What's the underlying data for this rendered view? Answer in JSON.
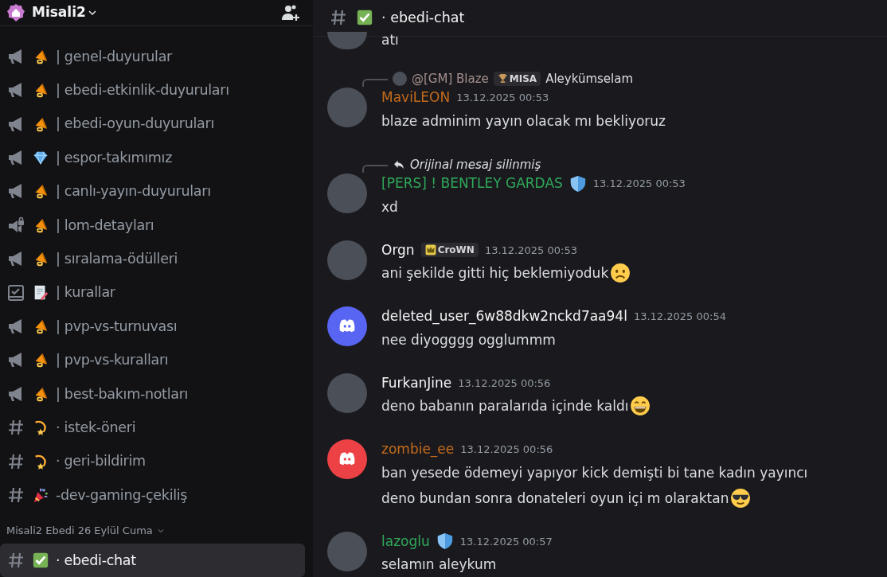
{
  "server": {
    "name": "Misali2"
  },
  "channels": [
    {
      "kind": "announcement",
      "emoji": {
        "kind": "megaphone"
      },
      "name": "| genel-duyurular"
    },
    {
      "kind": "announcement",
      "emoji": {
        "kind": "megaphone"
      },
      "name": "| ebedi-etkinlik-duyuruları"
    },
    {
      "kind": "announcement",
      "emoji": {
        "kind": "megaphone"
      },
      "name": "| ebedi-oyun-duyuruları"
    },
    {
      "kind": "announcement",
      "emoji": {
        "kind": "diamond"
      },
      "name": "| espor-takımımız"
    },
    {
      "kind": "announcement",
      "emoji": {
        "kind": "megaphone"
      },
      "name": "| canlı-yayın-duyuruları"
    },
    {
      "kind": "locked",
      "emoji": {
        "kind": "megaphone"
      },
      "name": "| lom-detayları"
    },
    {
      "kind": "announcement",
      "emoji": {
        "kind": "megaphone"
      },
      "name": "| sıralama-ödülleri"
    },
    {
      "kind": "rules",
      "emoji": {
        "kind": "memo"
      },
      "name": "| kurallar"
    },
    {
      "kind": "announcement",
      "emoji": {
        "kind": "megaphone"
      },
      "name": "| pvp-vs-turnuvası"
    },
    {
      "kind": "announcement",
      "emoji": {
        "kind": "megaphone"
      },
      "name": "| pvp-vs-kuralları"
    },
    {
      "kind": "announcement",
      "emoji": {
        "kind": "megaphone"
      },
      "name": "| best-bakım-notları"
    },
    {
      "kind": "text",
      "emoji": {
        "kind": "dizzy"
      },
      "name": "· istek-öneri"
    },
    {
      "kind": "text",
      "emoji": {
        "kind": "dizzy"
      },
      "name": "· geri-bildirim"
    },
    {
      "kind": "text",
      "emoji": {
        "kind": "party"
      },
      "name": "-dev-gaming-çekiliş"
    }
  ],
  "category": {
    "name": "Misali2 Ebedi 26 Eylül Cuma",
    "channels": [
      {
        "kind": "text",
        "emoji": {
          "kind": "check"
        },
        "name": "· ebedi-chat",
        "selected": true
      }
    ]
  },
  "header": {
    "emoji": {
      "kind": "check"
    },
    "channel": "· ebedi-chat"
  },
  "messages": [
    {
      "kind": "continuation",
      "avatar": {
        "kind": "photo"
      },
      "text": "atı"
    },
    {
      "kind": "full",
      "avatar": {
        "kind": "photo"
      },
      "reply": {
        "kind": "mention",
        "author": "@[GM] Blaze",
        "tag": "MISA",
        "text": "Aleykümselam"
      },
      "author": "MaviLEON",
      "color": "#c46a1b",
      "timestamp": "13.12.2025 00:53",
      "lines": [
        {
          "text": "blaze adminim yayın olacak mı bekliyoruz"
        }
      ]
    },
    {
      "kind": "full",
      "avatar": {
        "kind": "photo"
      },
      "reply": {
        "kind": "deleted",
        "text": "Orijinal mesaj silinmiş"
      },
      "author": "[PERS] ! BENTLEY GARDAS",
      "color": "#2fa85a",
      "role_icon": true,
      "timestamp": "13.12.2025 00:53",
      "lines": [
        {
          "text": "xd"
        }
      ]
    },
    {
      "kind": "full",
      "avatar": {
        "kind": "photo"
      },
      "author": "Orgn",
      "color": "#f2f3f5",
      "tag": "CroWN",
      "timestamp": "13.12.2025 00:53",
      "lines": [
        {
          "text": "ani şekilde gitti hiç beklemiyoduk",
          "emoji": {
            "kind": "sad"
          }
        }
      ]
    },
    {
      "kind": "full",
      "avatar": {
        "kind": "default",
        "color": "#5865f2"
      },
      "author": "deleted_user_6w88dkw2nckd7aa94l",
      "color": "#f2f3f5",
      "timestamp": "13.12.2025 00:54",
      "lines": [
        {
          "text": "nee diyogggg ogglummm"
        }
      ]
    },
    {
      "kind": "full",
      "avatar": {
        "kind": "photo"
      },
      "author": "FurkanJine",
      "color": "#f2f3f5",
      "timestamp": "13.12.2025 00:56",
      "lines": [
        {
          "text": "deno babanın paralarıda içinde kaldı",
          "emoji": {
            "kind": "grin"
          }
        }
      ]
    },
    {
      "kind": "full",
      "avatar": {
        "kind": "default",
        "color": "#ed4245"
      },
      "author": "zombie_ee",
      "color": "#c46a1b",
      "timestamp": "13.12.2025 00:56",
      "lines": [
        {
          "text": "ban yesede ödemeyi yapıyor kick demişti bi tane kadın yayıncı"
        },
        {
          "text": "deno bundan sonra donateleri oyun içi m olaraktan",
          "emoji": {
            "kind": "cool"
          }
        }
      ]
    },
    {
      "kind": "full",
      "avatar": {
        "kind": "photo"
      },
      "author": "lazoglu",
      "color": "#2fa85a",
      "role_icon": true,
      "timestamp": "13.12.2025 00:57",
      "lines": [
        {
          "text": "selamın aleykum"
        }
      ]
    }
  ]
}
